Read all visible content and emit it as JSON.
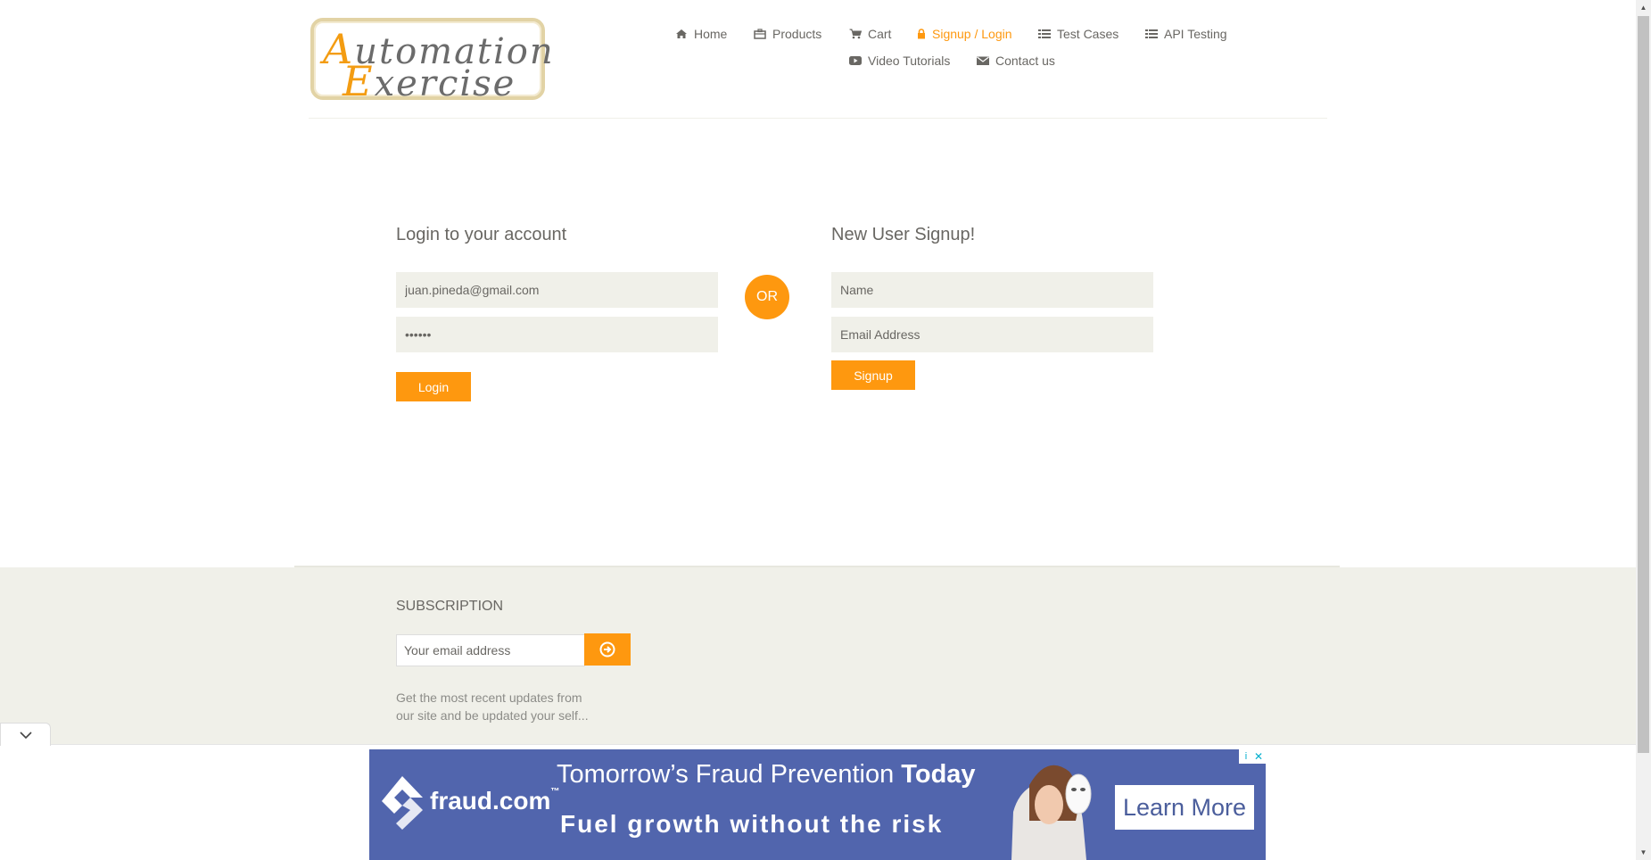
{
  "logo": {
    "line1_cap": "A",
    "line1_rest": "utomation",
    "line2_cap": "E",
    "line2_rest": "xercise"
  },
  "nav": {
    "home": "Home",
    "products": "Products",
    "cart": "Cart",
    "signup_login": "Signup / Login",
    "test_cases": "Test Cases",
    "api_testing": "API Testing",
    "video_tutorials": "Video Tutorials",
    "contact_us": "Contact us"
  },
  "login": {
    "title": "Login to your account",
    "email_value": "juan.pineda@gmail.com",
    "password_value": "••••••",
    "button": "Login"
  },
  "or_label": "OR",
  "signup": {
    "title": "New User Signup!",
    "name_placeholder": "Name",
    "email_placeholder": "Email Address",
    "button": "Signup"
  },
  "footer": {
    "subscription_title": "SUBSCRIPTION",
    "email_placeholder": "Your email address",
    "description": "Get the most recent updates from our site and be updated your self..."
  },
  "ad": {
    "brand": "fraud.com",
    "brand_tm": "™",
    "headline_plain": "Tomorrow’s Fraud Prevention",
    "headline_bold": "Today",
    "tagline": "Fuel growth without the risk",
    "cta": "Learn More",
    "adchoice": "i",
    "close": "✕"
  },
  "colors": {
    "accent": "#fe980f",
    "text": "#696763",
    "input_bg": "#f0f0e9",
    "ad_bg": "#5165ad"
  }
}
